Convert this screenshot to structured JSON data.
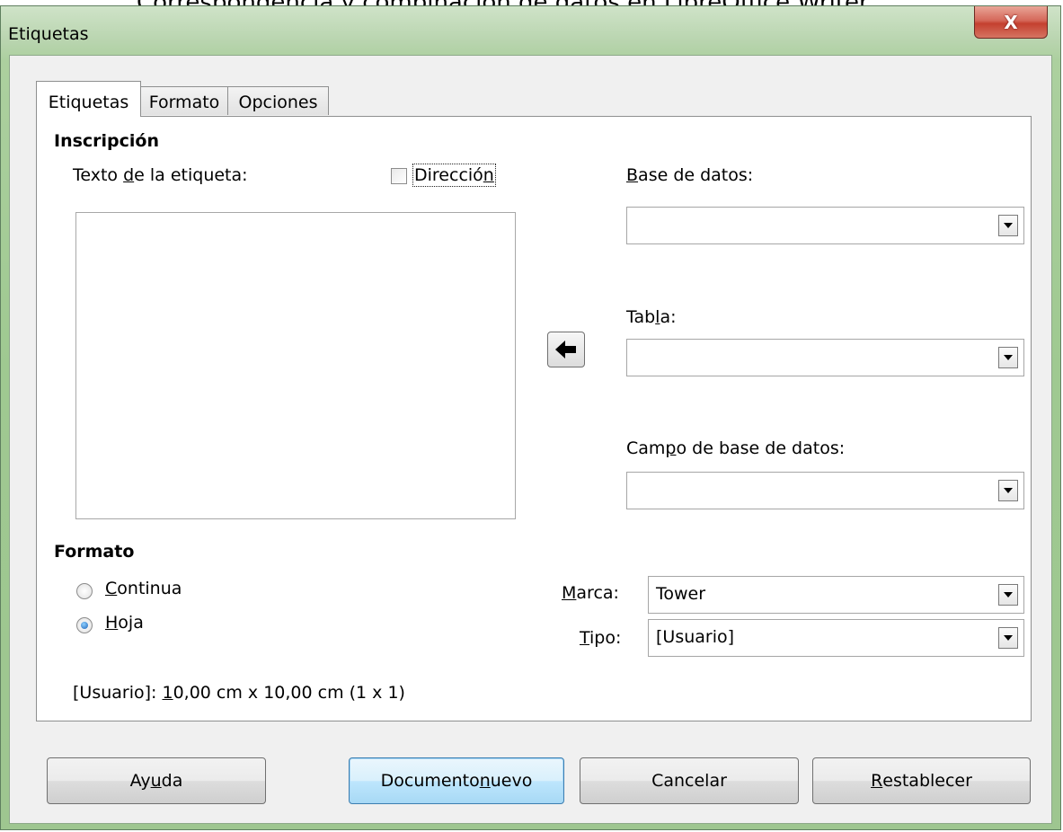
{
  "background_caption": "Correspondencia y combinación de datos en LibreOffice Writer",
  "window": {
    "title": "Etiquetas",
    "close_glyph": "X"
  },
  "tabs": [
    {
      "label": "Etiquetas",
      "active": true
    },
    {
      "label": "Formato",
      "active": false
    },
    {
      "label": "Opciones",
      "active": false
    }
  ],
  "inscripcion": {
    "heading": "Inscripción",
    "label_text_pre": "Texto ",
    "label_text_u": "d",
    "label_text_post": "e la etiqueta:",
    "address_checkbox_pre": "Direcció",
    "address_checkbox_u": "n",
    "address_checked": false,
    "label_text_value": ""
  },
  "database": {
    "db_label_u": "B",
    "db_label_post": "ase de datos:",
    "db_value": "",
    "table_label_pre": "Tab",
    "table_label_u": "l",
    "table_label_post": "a:",
    "table_value": "",
    "field_label_pre": "Cam",
    "field_label_u": "p",
    "field_label_post": "o de base de datos:",
    "field_value": ""
  },
  "formato": {
    "heading": "Formato",
    "continua_u": "C",
    "continua_post": "ontinua",
    "hoja_u": "H",
    "hoja_post": "oja",
    "selected": "Hoja",
    "marca_u": "M",
    "marca_post": "arca:",
    "marca_value": "Tower",
    "tipo_u": "T",
    "tipo_post": "ipo:",
    "tipo_value": "[Usuario]",
    "size_pre": "[Usuario]: ",
    "size_u": "1",
    "size_post": "0,00 cm x 10,00 cm (1 x 1)"
  },
  "buttons": {
    "help_pre": "Ay",
    "help_u": "u",
    "help_post": "da",
    "new_doc_pre": "Documento ",
    "new_doc_u": "n",
    "new_doc_post": "uevo",
    "cancel": "Cancelar",
    "reset_u": "R",
    "reset_post": "establecer"
  }
}
